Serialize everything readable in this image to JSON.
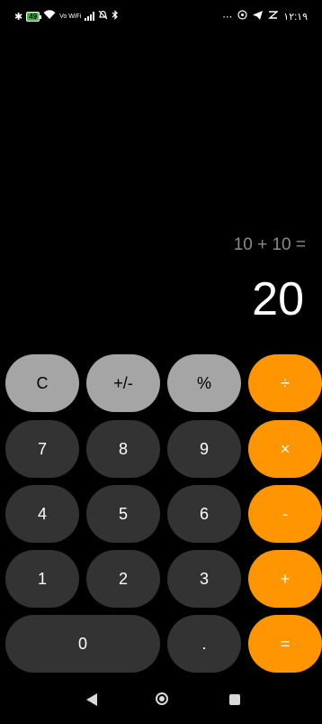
{
  "status_bar": {
    "battery": "49",
    "network_label": "Vo WiFi",
    "time": "١٢:١٩"
  },
  "display": {
    "expression": "10 + 10 =",
    "result": "20"
  },
  "keypad": {
    "clear": "C",
    "sign": "+/-",
    "percent": "%",
    "divide": "÷",
    "multiply": "×",
    "subtract": "-",
    "add": "+",
    "equals": "=",
    "decimal": ".",
    "digits": [
      "0",
      "1",
      "2",
      "3",
      "4",
      "5",
      "6",
      "7",
      "8",
      "9"
    ]
  },
  "colors": {
    "function_key": "#a5a5a5",
    "digit_key": "#333333",
    "operator_key": "#ff9500",
    "background": "#000000"
  }
}
